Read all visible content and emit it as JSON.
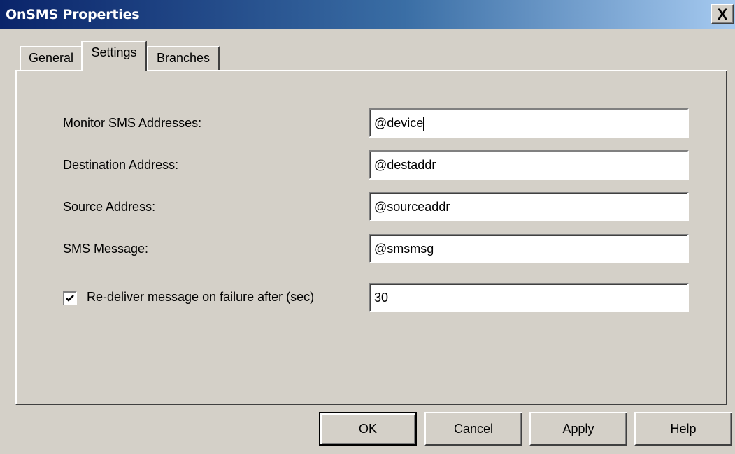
{
  "window": {
    "title": "OnSMS Properties",
    "close_label": "X"
  },
  "tabs": [
    {
      "label": "General"
    },
    {
      "label": "Settings"
    },
    {
      "label": "Branches"
    }
  ],
  "form": {
    "monitor_label": "Monitor SMS Addresses:",
    "monitor_value": "@device",
    "destination_label": "Destination Address:",
    "destination_value": "@destaddr",
    "source_label": "Source Address:",
    "source_value": "@sourceaddr",
    "message_label": "SMS Message:",
    "message_value": "@smsmsg",
    "redeliver_label": "Re-deliver message on failure after (sec)",
    "redeliver_checked": true,
    "redeliver_value": "30"
  },
  "buttons": {
    "ok": "OK",
    "cancel": "Cancel",
    "apply": "Apply",
    "help": "Help"
  }
}
